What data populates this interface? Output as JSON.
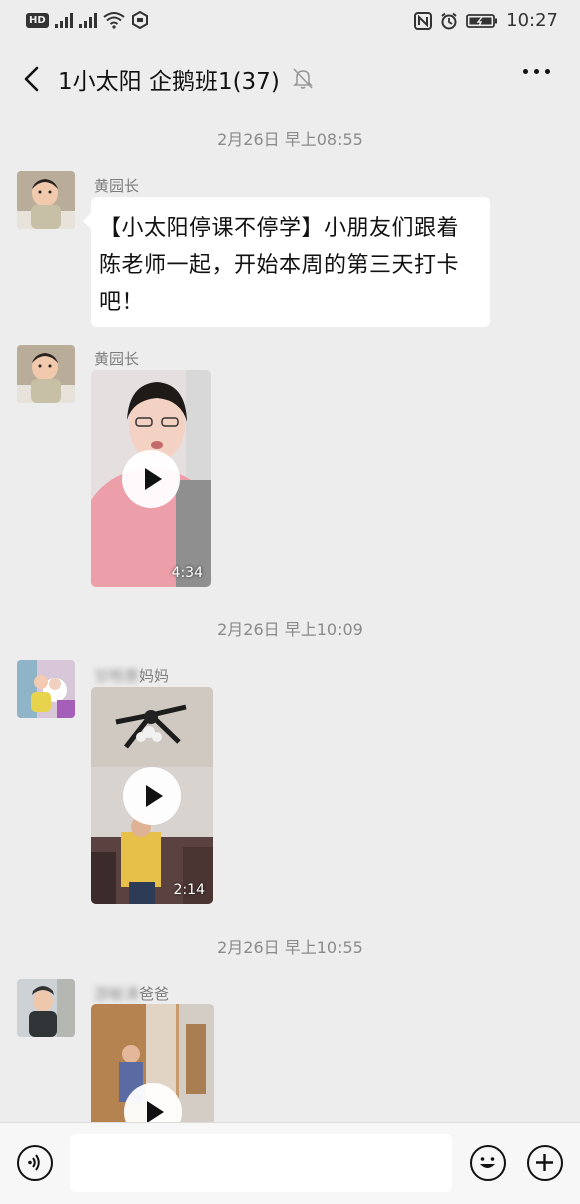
{
  "status_bar": {
    "left_icons": [
      "hd-icon",
      "signal-4g-icon",
      "signal-4g-icon",
      "wifi-icon",
      "hotspot-icon"
    ],
    "signal_label": "4G",
    "hd_label": "HD",
    "time": "10:27",
    "right_icons": [
      "nfc-icon",
      "alarm-icon",
      "battery-icon"
    ]
  },
  "header": {
    "title": "1小太阳 企鹅班1(37)",
    "muted": true
  },
  "messages": [
    {
      "timestamp": "2月26日 早上08:55"
    },
    {
      "sender": "黄园长",
      "type": "text",
      "text": "【小太阳停课不停学】小朋友们跟着陈老师一起，开始本周的第三天打卡吧！"
    },
    {
      "sender": "黄园长",
      "type": "video",
      "duration": "4:34"
    },
    {
      "timestamp": "2月26日 早上10:09"
    },
    {
      "sender_blurred": "甘畅惠",
      "sender_suffix": "妈妈",
      "type": "video",
      "duration": "2:14"
    },
    {
      "timestamp": "2月26日 早上10:55"
    },
    {
      "sender_blurred": "游敏湧",
      "sender_suffix": "爸爸",
      "type": "video",
      "duration": ""
    }
  ],
  "input_bar": {
    "left_icon": "voice-icon",
    "right_icons": [
      "emoji-icon",
      "plus-icon"
    ],
    "input_value": ""
  }
}
